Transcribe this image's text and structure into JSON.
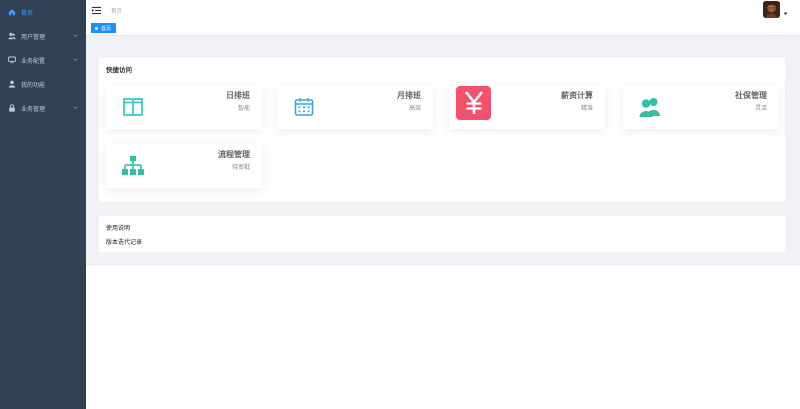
{
  "sidebar": {
    "items": [
      {
        "label": "首页"
      },
      {
        "label": "用户管理"
      },
      {
        "label": "业务配置"
      },
      {
        "label": "我的功能"
      },
      {
        "label": "业务管理"
      }
    ]
  },
  "header": {
    "breadcrumb": "首页"
  },
  "tags": {
    "active": "首页"
  },
  "quick": {
    "title": "快捷访问",
    "cards": [
      {
        "title": "日排班",
        "subtitle": "智能"
      },
      {
        "title": "月排班",
        "subtitle": "高效"
      },
      {
        "title": "薪资计算",
        "subtitle": "精准"
      },
      {
        "title": "社保管理",
        "subtitle": "灵活"
      },
      {
        "title": "流程管理",
        "subtitle": "待审批"
      }
    ]
  },
  "info": {
    "line1": "使用说明",
    "line2": "版本迭代记录"
  },
  "colors": {
    "sidebar_bg": "#304156",
    "active": "#409eff",
    "tag_bg": "#1890ff",
    "teal": "#40c9c6",
    "blue": "#36a3f7",
    "red": "#f4516c",
    "green": "#34bfa3"
  },
  "icons": {
    "menu": "hamburger-icon",
    "home": "home-icon",
    "user": "user-group-icon",
    "monitor": "monitor-icon",
    "person": "person-icon",
    "lock": "lock-icon",
    "layout": "layout-icon",
    "calendar": "calendar-icon",
    "yen": "yen-icon",
    "peoples": "peoples-icon",
    "tree": "tree-icon"
  }
}
